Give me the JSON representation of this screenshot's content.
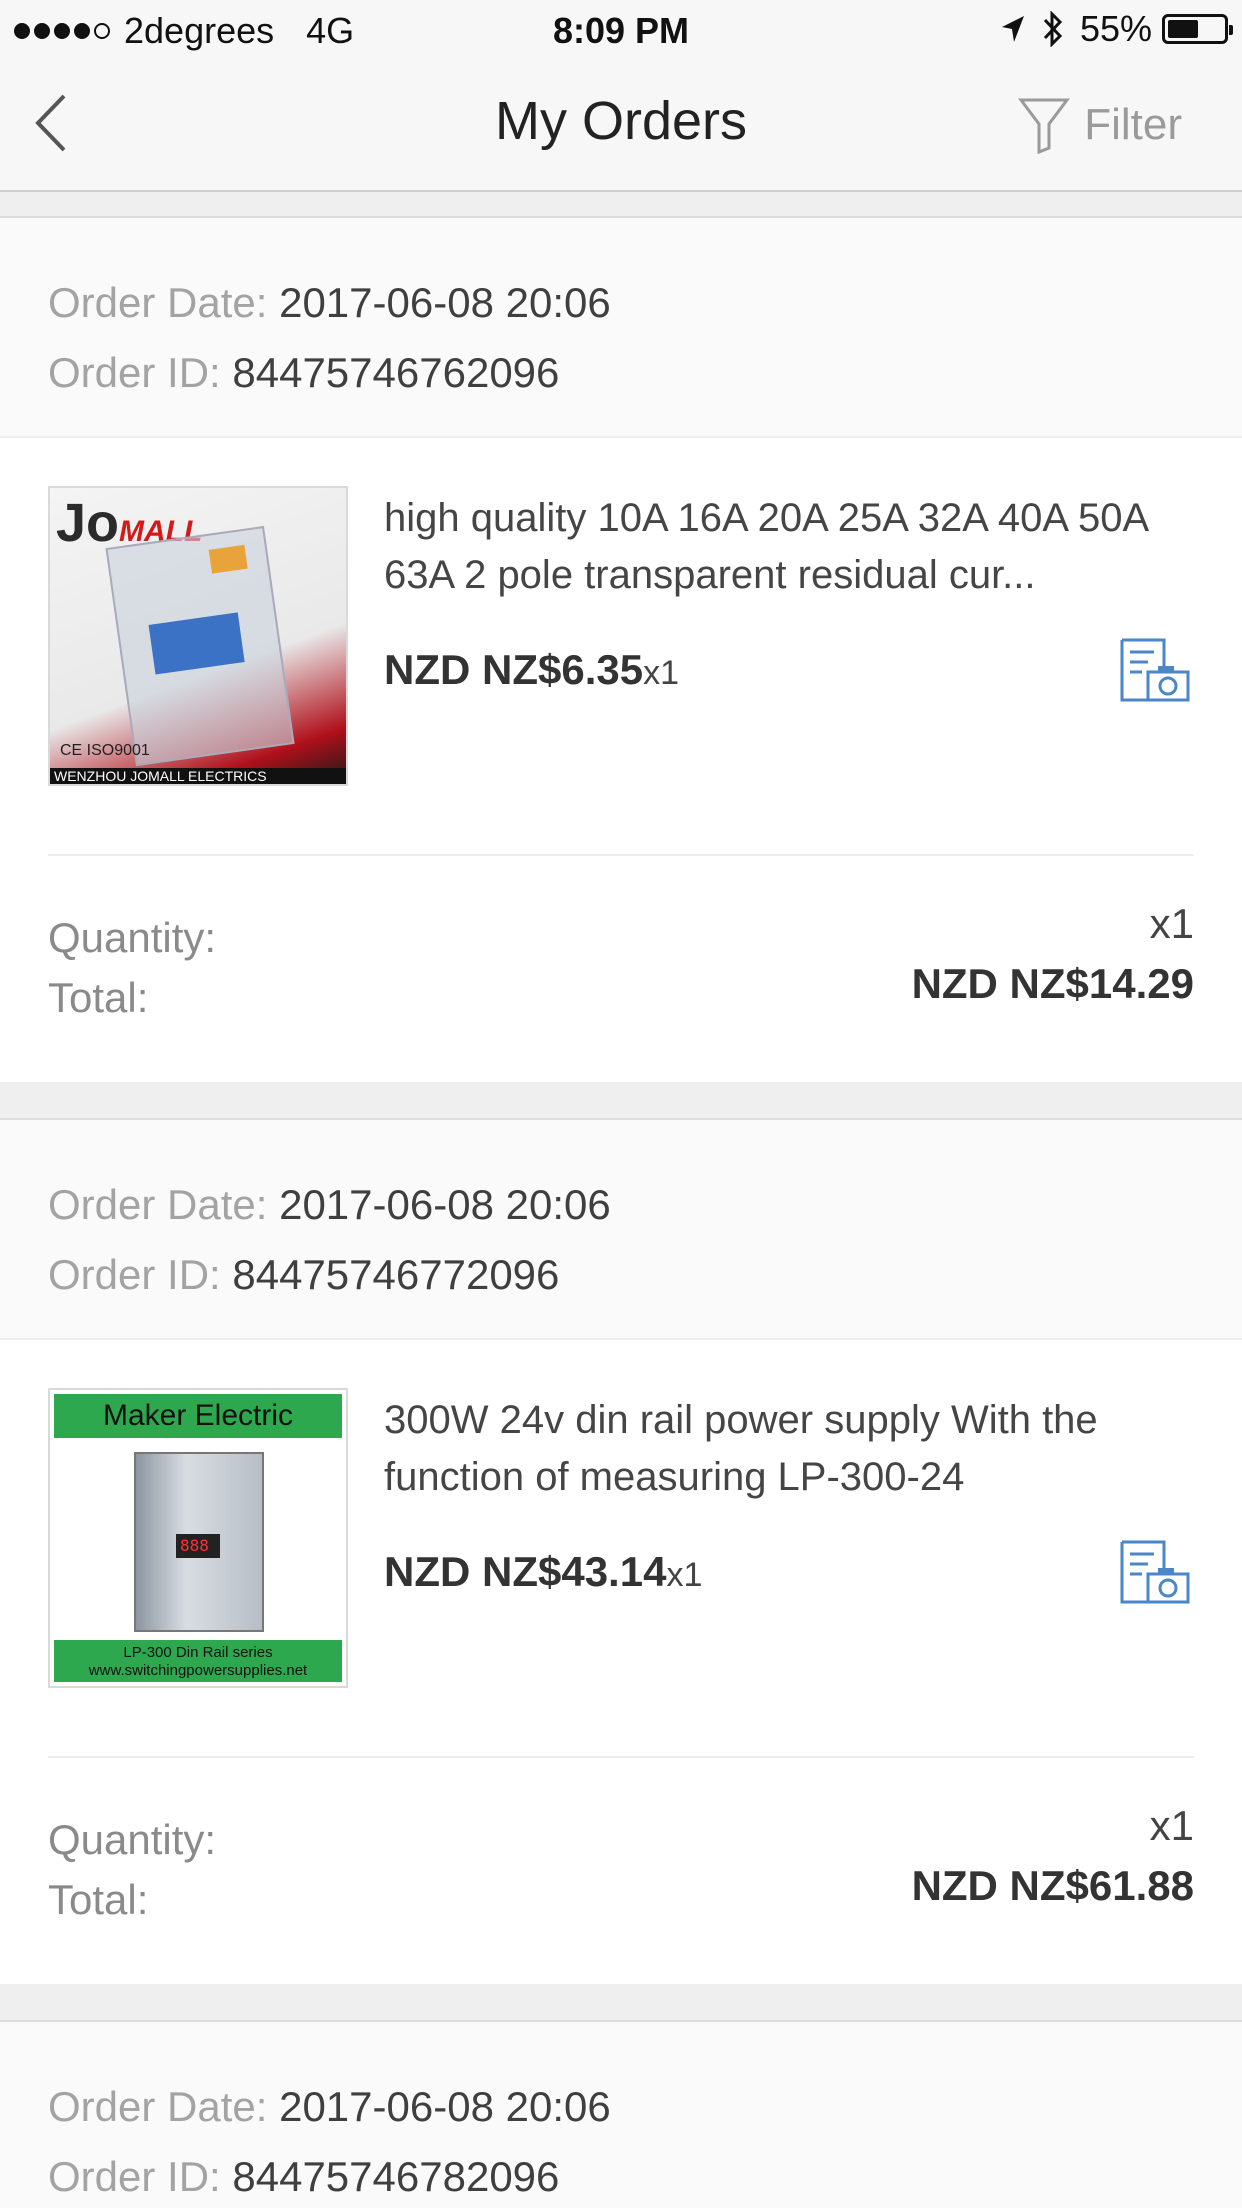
{
  "status_bar": {
    "carrier": "2degrees",
    "network": "4G",
    "time": "8:09 PM",
    "battery_percent": "55%",
    "battery_level": 0.55,
    "icons": [
      "location-arrow-icon",
      "bluetooth-icon",
      "battery-icon"
    ]
  },
  "nav": {
    "title": "My Orders",
    "filter_label": "Filter",
    "back_icon": "chevron-left-icon",
    "filter_icon": "funnel-icon"
  },
  "labels": {
    "order_date": "Order Date: ",
    "order_id": "Order ID: ",
    "quantity": "Quantity:",
    "total": "Total:"
  },
  "orders": [
    {
      "order_date": "2017-06-08 20:06",
      "order_id": "84475746762096",
      "product": {
        "title": "high quality 10A 16A 20A 25A 32A 40A 50A 63A 2 pole transparent residual cur...",
        "price": "NZD NZ$6.35",
        "qty": "x1",
        "thumb_text": {
          "brand": "Jo",
          "brand_suffix": "MALL",
          "cert": "CE  ISO9001",
          "maker": "WENZHOU JOMALL ELECTRICS"
        }
      },
      "quantity": "x1",
      "total": "NZD NZ$14.29"
    },
    {
      "order_date": "2017-06-08 20:06",
      "order_id": "84475746772096",
      "product": {
        "title": "300W 24v din rail  power supply With the function of measuring LP-300-24",
        "price": "NZD NZ$43.14",
        "qty": "x1",
        "thumb_text": {
          "top": "Maker Electric",
          "bottom1": "LP-300 Din Rail series",
          "bottom2": "www.switchingpowersupplies.net"
        }
      },
      "quantity": "x1",
      "total": "NZD NZ$61.88"
    },
    {
      "order_date": "2017-06-08 20:06",
      "order_id": "84475746782096"
    }
  ],
  "colors": {
    "accent_blue": "#4a86c8",
    "label_gray": "#a3a3a3",
    "background": "#efefef"
  }
}
